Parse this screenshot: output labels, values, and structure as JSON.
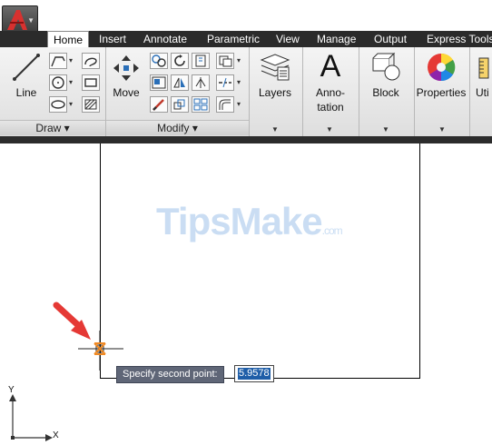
{
  "app": {
    "logo_icon": "autocad-logo-icon"
  },
  "tabs": [
    "Home",
    "Insert",
    "Annotate",
    "Parametric",
    "View",
    "Manage",
    "Output",
    "Express Tools"
  ],
  "ribbon": {
    "line_label": "Line",
    "move_label": "Move",
    "draw_panel": "Draw ▾",
    "modify_panel": "Modify ▾",
    "layers_label": "Layers",
    "annotation_label_1": "Anno-",
    "annotation_label_2": "tation",
    "block_label": "Block",
    "properties_label": "Properties",
    "utilities_label": "Uti"
  },
  "command": {
    "prompt": "Specify second point:",
    "value": "5.9578"
  },
  "watermark": {
    "main": "TipsMake",
    "suffix": ".com"
  },
  "ucs": {
    "x": "X",
    "y": "Y"
  },
  "colors": {
    "ribbon_dark": "#2b2b2b",
    "prompt_bg": "#5f6677",
    "highlight": "#1f5ea8",
    "arrow": "#e53935"
  }
}
